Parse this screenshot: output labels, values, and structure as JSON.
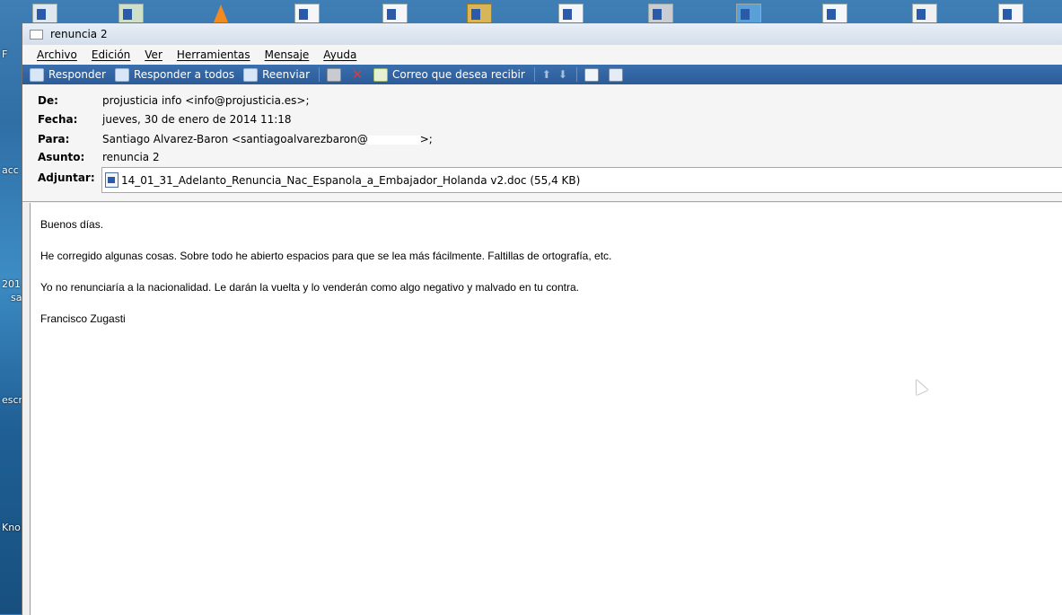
{
  "window": {
    "title": "renuncia 2"
  },
  "menu": [
    "Archivo",
    "Edición",
    "Ver",
    "Herramientas",
    "Mensaje",
    "Ayuda"
  ],
  "toolbar": {
    "reply": "Responder",
    "reply_all": "Responder a todos",
    "forward": "Reenviar",
    "receive": "Correo que desea recibir"
  },
  "header": {
    "from_label": "De:",
    "from_value": "projusticia info <info@projusticia.es>;",
    "date_label": "Fecha:",
    "date_value": "jueves, 30 de enero de 2014 11:18",
    "to_label": "Para:",
    "to_value_start": "Santiago Alvarez-Baron <santiagoalvarezbaron@",
    "to_value_end": ">;",
    "subject_label": "Asunto:",
    "subject_value": "renuncia 2",
    "attach_label": "Adjuntar:",
    "attach_value": "14_01_31_Adelanto_Renuncia_Nac_Espanola_a_Embajador_Holanda v2.doc (55,4 KB)"
  },
  "body": {
    "p1": "Buenos días.",
    "p2": "He corregido algunas cosas. Sobre todo he abierto espacios para que se lea más fácilmente. Faltillas de ortografía, etc.",
    "p3": "Yo no renunciaría a la nacionalidad. Le darán la vuelta y lo venderán como algo negativo y malvado en tu contra.",
    "p4": "Francisco Zugasti"
  },
  "desktop": {
    "side_labels": [
      "F",
      "acc",
      "201",
      "sa",
      "escr",
      "Kno"
    ]
  }
}
